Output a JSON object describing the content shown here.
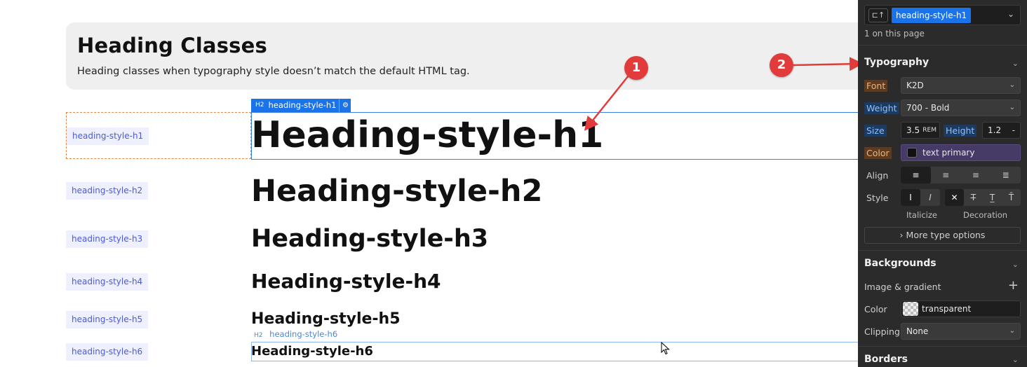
{
  "canvas": {
    "banner": {
      "title": "Heading Classes",
      "description": "Heading classes when typography style doesn’t match the default HTML tag."
    },
    "rows": [
      {
        "label": "heading-style-h1",
        "text": "Heading-style-h1"
      },
      {
        "label": "heading-style-h2",
        "text": "Heading-style-h2"
      },
      {
        "label": "heading-style-h3",
        "text": "Heading-style-h3"
      },
      {
        "label": "heading-style-h4",
        "text": "Heading-style-h4"
      },
      {
        "label": "heading-style-h5",
        "text": "Heading-style-h5"
      },
      {
        "label": "heading-style-h6",
        "text": "Heading-style-h6"
      }
    ],
    "selected_tag": {
      "level": "H2",
      "name": "heading-style-h1"
    },
    "hover_tag": {
      "level": "H2",
      "name": "heading-style-h6"
    },
    "annotations": [
      "1",
      "2"
    ],
    "accent_color": "#1a73e8",
    "annotation_color": "#e23b3b"
  },
  "panel": {
    "selector": {
      "chip": "heading-style-h1",
      "count_text": "1 on this page"
    },
    "typography": {
      "title": "Typography",
      "font_label": "Font",
      "font_value": "K2D",
      "weight_label": "Weight",
      "weight_value": "700 - Bold",
      "size_label": "Size",
      "size_value": "3.5",
      "size_unit": "REM",
      "height_label": "Height",
      "height_value": "1.2",
      "height_unit": "-",
      "color_label": "Color",
      "color_value": "text primary",
      "align_label": "Align",
      "style_label": "Style",
      "italicize_caption": "Italicize",
      "decoration_caption": "Decoration",
      "italic_opts": [
        "I",
        "I"
      ],
      "more_options": "More type options"
    },
    "backgrounds": {
      "title": "Backgrounds",
      "image_label": "Image & gradient",
      "color_label": "Color",
      "color_value": "transparent",
      "clipping_label": "Clipping",
      "clipping_value": "None"
    },
    "borders": {
      "title": "Borders"
    }
  }
}
